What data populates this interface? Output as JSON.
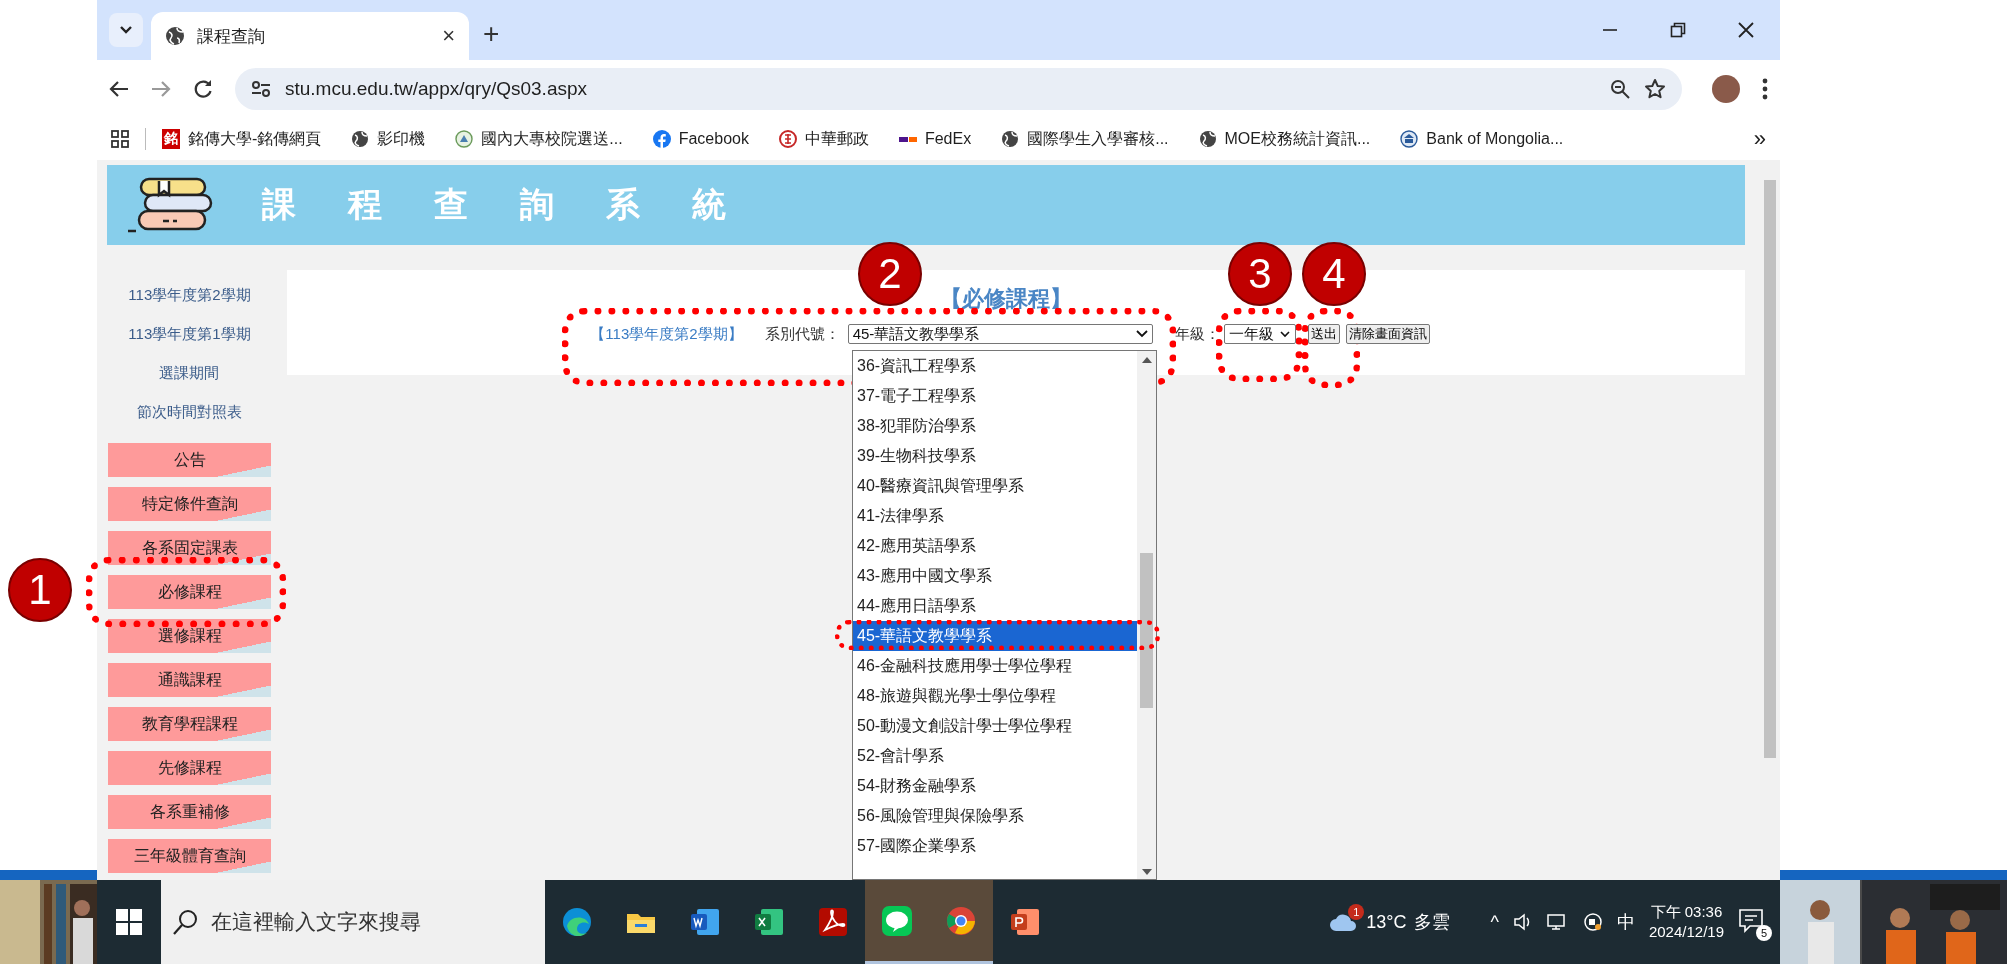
{
  "browser": {
    "tab": {
      "title": "課程查詢",
      "close": "×"
    },
    "new_tab": "+",
    "url": "stu.mcu.edu.tw/appx/qry/Qs03.aspx",
    "bookmarks": [
      {
        "label": "銘傳大學-銘傳網頁",
        "kind": "mark",
        "mark": "銘"
      },
      {
        "label": "影印機",
        "kind": "globe"
      },
      {
        "label": "國內大專校院選送...",
        "kind": "seal"
      },
      {
        "label": "Facebook",
        "kind": "facebook"
      },
      {
        "label": "中華郵政",
        "kind": "post"
      },
      {
        "label": "FedEx",
        "kind": "fedex"
      },
      {
        "label": "國際學生入學審核...",
        "kind": "globe"
      },
      {
        "label": "MOE校務統計資訊...",
        "kind": "globe"
      },
      {
        "label": "Bank of Mongolia...",
        "kind": "bank"
      }
    ],
    "overflow": "»"
  },
  "page": {
    "title": "課程查詢系統",
    "sidebar": {
      "links": [
        "113學年度第2學期",
        "113學年度第1學期",
        "選課期間",
        "節次時間對照表"
      ],
      "menu": [
        "公告",
        "特定條件查詢",
        "各系固定課表",
        "必修課程",
        "選修課程",
        "通識課程",
        "教育學程課程",
        "先修課程",
        "各系重補修",
        "三年級體育查詢"
      ]
    },
    "content": {
      "heading": "【必修課程】",
      "term": "【113學年度第2學期】",
      "dept_label": "系別代號：",
      "dept_value": "45-華語文教學學系",
      "grade_label": "年級：",
      "grade_value": "一年級",
      "buttons": [
        "送出",
        "清除畫面資訊"
      ]
    },
    "dept_options": [
      {
        "label": "36-資訊工程學系",
        "selected": false
      },
      {
        "label": "37-電子工程學系",
        "selected": false
      },
      {
        "label": "38-犯罪防治學系",
        "selected": false
      },
      {
        "label": "39-生物科技學系",
        "selected": false
      },
      {
        "label": "40-醫療資訊與管理學系",
        "selected": false
      },
      {
        "label": "41-法律學系",
        "selected": false
      },
      {
        "label": "42-應用英語學系",
        "selected": false
      },
      {
        "label": "43-應用中國文學系",
        "selected": false
      },
      {
        "label": "44-應用日語學系",
        "selected": false
      },
      {
        "label": "45-華語文教學學系",
        "selected": true
      },
      {
        "label": "46-金融科技應用學士學位學程",
        "selected": false
      },
      {
        "label": "48-旅遊與觀光學士學位學程",
        "selected": false
      },
      {
        "label": "50-動漫文創設計學士學位學程",
        "selected": false
      },
      {
        "label": "52-會計學系",
        "selected": false
      },
      {
        "label": "54-財務金融學系",
        "selected": false
      },
      {
        "label": "56-風險管理與保險學系",
        "selected": false
      },
      {
        "label": "57-國際企業學系",
        "selected": false
      }
    ]
  },
  "annotations": [
    {
      "number": "1"
    },
    {
      "number": "2"
    },
    {
      "number": "3"
    },
    {
      "number": "4"
    }
  ],
  "taskbar": {
    "search": {
      "placeholder": "在這裡輸入文字來搜尋"
    },
    "apps": [
      {
        "kind": "edge",
        "active": false
      },
      {
        "kind": "folder",
        "active": false
      },
      {
        "kind": "word",
        "active": false
      },
      {
        "kind": "excel",
        "active": false
      },
      {
        "kind": "acrobat",
        "active": false
      },
      {
        "kind": "line",
        "active": true
      },
      {
        "kind": "chrome",
        "active": true
      },
      {
        "kind": "powerpoint",
        "active": false
      }
    ],
    "weather": {
      "alert": "1",
      "temperature": "13°C",
      "condition": "多雲"
    },
    "tray": {
      "chevron": "^",
      "ime": "中",
      "time": "下午 03:36",
      "date": "2024/12/19",
      "notifications": "5"
    }
  }
}
